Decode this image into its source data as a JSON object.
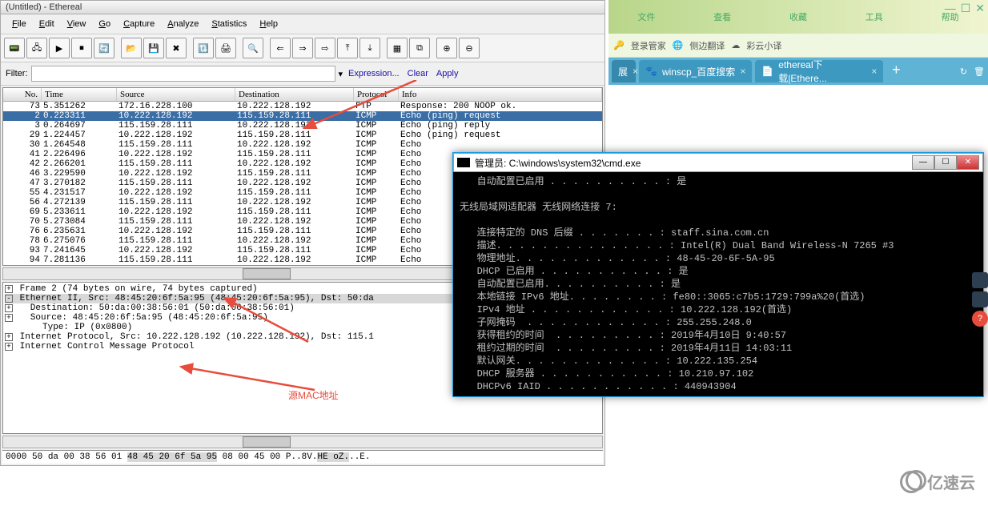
{
  "ethereal": {
    "title": "(Untitled) - Ethereal",
    "menu": [
      "File",
      "Edit",
      "View",
      "Go",
      "Capture",
      "Analyze",
      "Statistics",
      "Help"
    ],
    "filter_label": "Filter:",
    "filter_actions": {
      "expression": "Expression...",
      "clear": "Clear",
      "apply": "Apply"
    },
    "packet_cols": [
      "No.",
      "Time",
      "Source",
      "Destination",
      "Protocol",
      "Info"
    ],
    "packets": [
      {
        "no": "73",
        "time": "5.351262",
        "src": "172.16.228.100",
        "dst": "10.222.128.192",
        "proto": "FTP",
        "info": "Response: 200 NOOP ok."
      },
      {
        "no": "2",
        "time": "0.223311",
        "src": "10.222.128.192",
        "dst": "115.159.28.111",
        "proto": "ICMP",
        "info": "Echo (ping) request",
        "sel": true
      },
      {
        "no": "3",
        "time": "0.264697",
        "src": "115.159.28.111",
        "dst": "10.222.128.192",
        "proto": "ICMP",
        "info": "Echo (ping) reply"
      },
      {
        "no": "29",
        "time": "1.224457",
        "src": "10.222.128.192",
        "dst": "115.159.28.111",
        "proto": "ICMP",
        "info": "Echo (ping) request"
      },
      {
        "no": "30",
        "time": "1.264548",
        "src": "115.159.28.111",
        "dst": "10.222.128.192",
        "proto": "ICMP",
        "info": "Echo"
      },
      {
        "no": "41",
        "time": "2.226496",
        "src": "10.222.128.192",
        "dst": "115.159.28.111",
        "proto": "ICMP",
        "info": "Echo"
      },
      {
        "no": "42",
        "time": "2.266201",
        "src": "115.159.28.111",
        "dst": "10.222.128.192",
        "proto": "ICMP",
        "info": "Echo"
      },
      {
        "no": "46",
        "time": "3.229590",
        "src": "10.222.128.192",
        "dst": "115.159.28.111",
        "proto": "ICMP",
        "info": "Echo"
      },
      {
        "no": "47",
        "time": "3.270182",
        "src": "115.159.28.111",
        "dst": "10.222.128.192",
        "proto": "ICMP",
        "info": "Echo"
      },
      {
        "no": "55",
        "time": "4.231517",
        "src": "10.222.128.192",
        "dst": "115.159.28.111",
        "proto": "ICMP",
        "info": "Echo"
      },
      {
        "no": "56",
        "time": "4.272139",
        "src": "115.159.28.111",
        "dst": "10.222.128.192",
        "proto": "ICMP",
        "info": "Echo"
      },
      {
        "no": "69",
        "time": "5.233611",
        "src": "10.222.128.192",
        "dst": "115.159.28.111",
        "proto": "ICMP",
        "info": "Echo"
      },
      {
        "no": "70",
        "time": "5.273084",
        "src": "115.159.28.111",
        "dst": "10.222.128.192",
        "proto": "ICMP",
        "info": "Echo"
      },
      {
        "no": "76",
        "time": "6.235631",
        "src": "10.222.128.192",
        "dst": "115.159.28.111",
        "proto": "ICMP",
        "info": "Echo"
      },
      {
        "no": "78",
        "time": "6.275076",
        "src": "115.159.28.111",
        "dst": "10.222.128.192",
        "proto": "ICMP",
        "info": "Echo"
      },
      {
        "no": "93",
        "time": "7.241645",
        "src": "10.222.128.192",
        "dst": "115.159.28.111",
        "proto": "ICMP",
        "info": "Echo"
      },
      {
        "no": "94",
        "time": "7.281136",
        "src": "115.159.28.111",
        "dst": "10.222.128.192",
        "proto": "ICMP",
        "info": "Echo"
      }
    ],
    "tree": [
      {
        "exp": "+",
        "txt": "Frame 2 (74 bytes on wire, 74 bytes captured)"
      },
      {
        "exp": "-",
        "txt": "Ethernet II, Src: 48:45:20:6f:5a:95 (48:45:20:6f:5a:95), Dst: 50:da",
        "hi": true
      },
      {
        "exp": "+",
        "txt": "  Destination: 50:da:00:38:56:01 (50:da:00:38:56:01)"
      },
      {
        "exp": "+",
        "txt": "  Source: 48:45:20:6f:5a:95 (48:45:20:6f:5a:95)"
      },
      {
        "exp": "",
        "txt": "    Type: IP (0x0800)"
      },
      {
        "exp": "+",
        "txt": "Internet Protocol, Src: 10.222.128.192 (10.222.128.192), Dst: 115.1"
      },
      {
        "exp": "+",
        "txt": "Internet Control Message Protocol"
      }
    ],
    "annotation_src": "源MAC地址",
    "hex_line": "0000  50 da 00 38 56 01 48 45  20 6f 5a 95 08 00 45 00   P..8V.HE  oZ...E."
  },
  "cmd": {
    "title": "管理员: C:\\windows\\system32\\cmd.exe",
    "lines": [
      "   自动配置已启用 . . . . . . . . . . : 是",
      "",
      "无线局域网适配器 无线网络连接 7:",
      "",
      "   连接特定的 DNS 后缀 . . . . . . . : staff.sina.com.cn",
      "   描述. . . . . . . . . . . . . . . : Intel(R) Dual Band Wireless-N 7265 #3",
      "   物理地址. . . . . . . . . . . . . : 48-45-20-6F-5A-95",
      "   DHCP 已启用 . . . . . . . . . . . : 是",
      "   自动配置已启用. . . . . . . . . . : 是",
      "   本地链接 IPv6 地址. . . . . . . . : fe80::3065:c7b5:1729:799a%20(首选)",
      "   IPv4 地址 . . . . . . . . . . . . : 10.222.128.192(首选)",
      "   子网掩码  . . . . . . . . . . . . : 255.255.248.0",
      "   获得租约的时间  . . . . . . . . . : 2019年4月10日 9:40:57",
      "   租约过期的时间  . . . . . . . . . : 2019年4月11日 14:03:11",
      "   默认网关. . . . . . . . . . . . . : 10.222.135.254",
      "   DHCP 服务器 . . . . . . . . . . . : 10.210.97.102",
      "   DHCPv6 IAID . . . . . . . . . . . : 440943904"
    ]
  },
  "browser": {
    "top_menu": [
      "文件",
      "查看",
      "收藏",
      "工具",
      "帮助"
    ],
    "bookmarks": [
      "登录管家",
      "侧边翻译",
      "彩云小译"
    ],
    "tabs": [
      {
        "label": "展",
        "narrow": true
      },
      {
        "label": "winscp_百度搜索"
      },
      {
        "label": "ethereal下载|Ethere..."
      }
    ]
  },
  "watermark": "亿速云"
}
